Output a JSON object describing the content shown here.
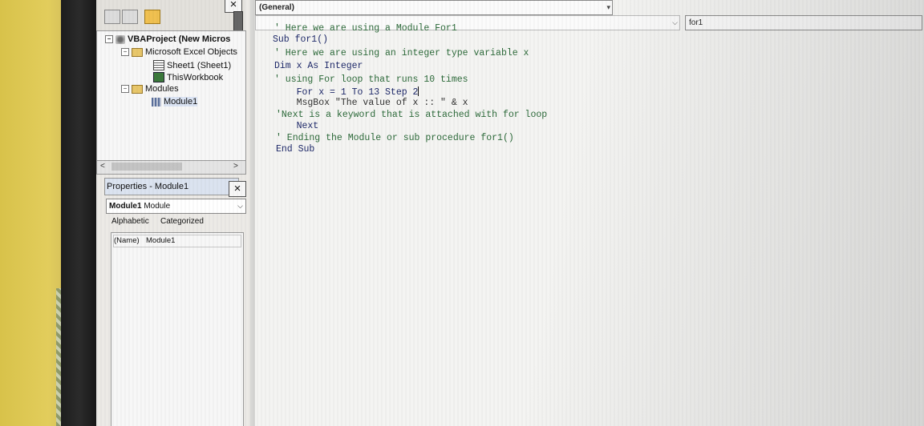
{
  "project_explorer": {
    "tree": [
      {
        "label": "VBAProject (New Micros",
        "icon": "vbaproject-icon",
        "expand": "−"
      },
      {
        "label": "Microsoft Excel Objects",
        "icon": "folder-icon",
        "expand": "−"
      },
      {
        "label": "Sheet1 (Sheet1)",
        "icon": "worksheet-icon"
      },
      {
        "label": "ThisWorkbook",
        "icon": "workbook-icon"
      },
      {
        "label": "Modules",
        "icon": "folder-icon",
        "expand": "−"
      },
      {
        "label": "Module1",
        "icon": "module-icon"
      }
    ]
  },
  "properties": {
    "title": "Properties - Module1",
    "object_name": "Module1",
    "object_type": "Module",
    "tab_alphabetic": "Alphabetic",
    "tab_categorized": "Categorized",
    "row_name": "(Name)",
    "row_value": "Module1"
  },
  "code_window": {
    "object_combo": "(General)",
    "procedure_combo": "for1",
    "lines": [
      "' Here we are using a Module For1",
      "Sub for1()",
      "' Here we are using an integer type variable x",
      "Dim x As Integer",
      "' using For loop that runs 10 times",
      "    For x = 1 To 13 Step 2",
      "    MsgBox \"The value of x :: \" & x",
      "'Next is a keyword that is attached with for loop",
      "    Next",
      "' Ending the Module or sub procedure for1()",
      "End Sub"
    ]
  }
}
